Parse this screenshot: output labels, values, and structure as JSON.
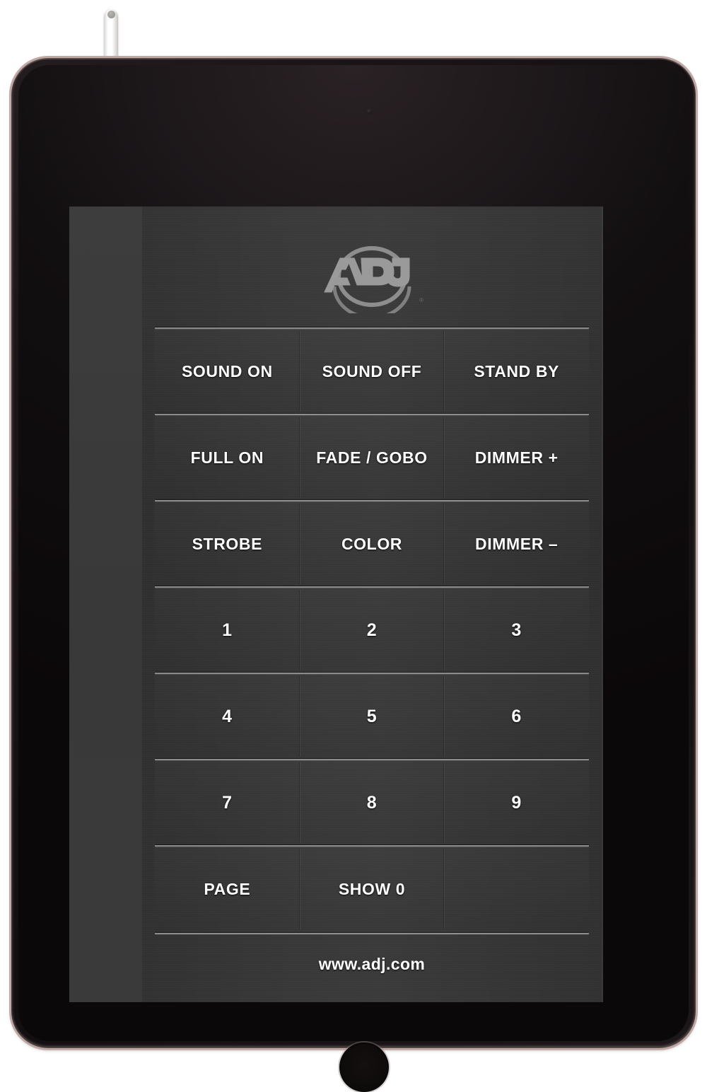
{
  "device": {
    "type": "tablet",
    "stylus_label": "stylus",
    "home_button_label": "Home",
    "front_camera_label": "Front camera",
    "bezel_color": "#120e10",
    "frame_accent_color": "#c0a9a5"
  },
  "app": {
    "brand": "ADJ",
    "logo_alt": "ADJ",
    "logo_registered_mark": "®",
    "logo_color": "#8a8a8a",
    "panel_color": "#323232",
    "screen_bg_color": "#3a3a3a",
    "label_color": "#ffffff",
    "footer_url": "www.adj.com",
    "grid": {
      "columns": 3,
      "rows": [
        [
          {
            "label": "SOUND ON",
            "name": "sound-on",
            "kind": "function"
          },
          {
            "label": "SOUND OFF",
            "name": "sound-off",
            "kind": "function"
          },
          {
            "label": "STAND BY",
            "name": "stand-by",
            "kind": "function"
          }
        ],
        [
          {
            "label": "FULL ON",
            "name": "full-on",
            "kind": "function"
          },
          {
            "label": "FADE / GOBO",
            "name": "fade-gobo",
            "kind": "function"
          },
          {
            "label": "DIMMER +",
            "name": "dimmer-plus",
            "kind": "function"
          }
        ],
        [
          {
            "label": "STROBE",
            "name": "strobe",
            "kind": "function"
          },
          {
            "label": "COLOR",
            "name": "color",
            "kind": "function"
          },
          {
            "label": "DIMMER –",
            "name": "dimmer-minus",
            "kind": "function"
          }
        ],
        [
          {
            "label": "1",
            "name": "1",
            "kind": "numeric"
          },
          {
            "label": "2",
            "name": "2",
            "kind": "numeric"
          },
          {
            "label": "3",
            "name": "3",
            "kind": "numeric"
          }
        ],
        [
          {
            "label": "4",
            "name": "4",
            "kind": "numeric"
          },
          {
            "label": "5",
            "name": "5",
            "kind": "numeric"
          },
          {
            "label": "6",
            "name": "6",
            "kind": "numeric"
          }
        ],
        [
          {
            "label": "7",
            "name": "7",
            "kind": "numeric"
          },
          {
            "label": "8",
            "name": "8",
            "kind": "numeric"
          },
          {
            "label": "9",
            "name": "9",
            "kind": "numeric"
          }
        ],
        [
          {
            "label": "PAGE",
            "name": "page",
            "kind": "function"
          },
          {
            "label": "SHOW 0",
            "name": "show-0",
            "kind": "function"
          },
          {
            "label": "",
            "name": "blank",
            "kind": "empty"
          }
        ]
      ]
    }
  }
}
